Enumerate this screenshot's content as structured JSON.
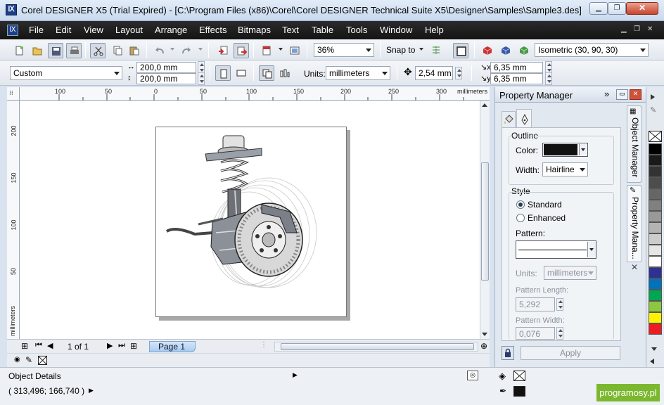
{
  "title": "Corel DESIGNER X5 (Trial Expired) - [C:\\Program Files (x86)\\Corel\\Corel DESIGNER Technical Suite X5\\Designer\\Samples\\Sample3.des]",
  "menu": [
    "File",
    "Edit",
    "View",
    "Layout",
    "Arrange",
    "Effects",
    "Bitmaps",
    "Text",
    "Table",
    "Tools",
    "Window",
    "Help"
  ],
  "toolbar1": {
    "zoom": "36%",
    "snap_to": "Snap to",
    "projection": "Isometric (30, 90, 30)"
  },
  "toolbar2": {
    "page_preset": "Custom",
    "width": "200,0 mm",
    "height": "200,0 mm",
    "units_label": "Units:",
    "units": "millimeters",
    "nudge": "2,54 mm",
    "dup_x": "6,35 mm",
    "dup_y": "6,35 mm"
  },
  "ruler": {
    "unit": "millimeters",
    "h_ticks": [
      "100",
      "50",
      "0",
      "50",
      "100",
      "150",
      "200",
      "250",
      "300"
    ],
    "v_ticks": [
      "200",
      "150",
      "100",
      "50"
    ]
  },
  "pagebar": {
    "page_counter": "1 of 1",
    "page_tab": "Page 1"
  },
  "status": {
    "object_details": "Object Details",
    "coords": "( 313,496; 166,740 )"
  },
  "property_manager": {
    "title": "Property Manager",
    "outline_label": "Outline",
    "color_label": "Color:",
    "width_label": "Width:",
    "width_value": "Hairline",
    "style_label": "Style",
    "standard": "Standard",
    "enhanced": "Enhanced",
    "pattern_label": "Pattern:",
    "units_label": "Units:",
    "units_value": "millimeters",
    "pattern_length_label": "Pattern Length:",
    "pattern_length": "5,292",
    "pattern_width_label": "Pattern Width:",
    "pattern_width": "0,076",
    "apply": "Apply",
    "outline_color": "#111111"
  },
  "side_tabs": {
    "object_manager": "Object Manager",
    "property_manager": "Property Mana..."
  },
  "palette": [
    "#000000",
    "#1a1a1a",
    "#333333",
    "#4d4d4d",
    "#666666",
    "#808080",
    "#999999",
    "#b3b3b3",
    "#cccccc",
    "#e6e6e6",
    "#ffffff",
    "#2e3192",
    "#0072bc",
    "#00a651",
    "#8dc63f",
    "#fff200",
    "#ed1c24"
  ],
  "watermark": "programosy.pl"
}
